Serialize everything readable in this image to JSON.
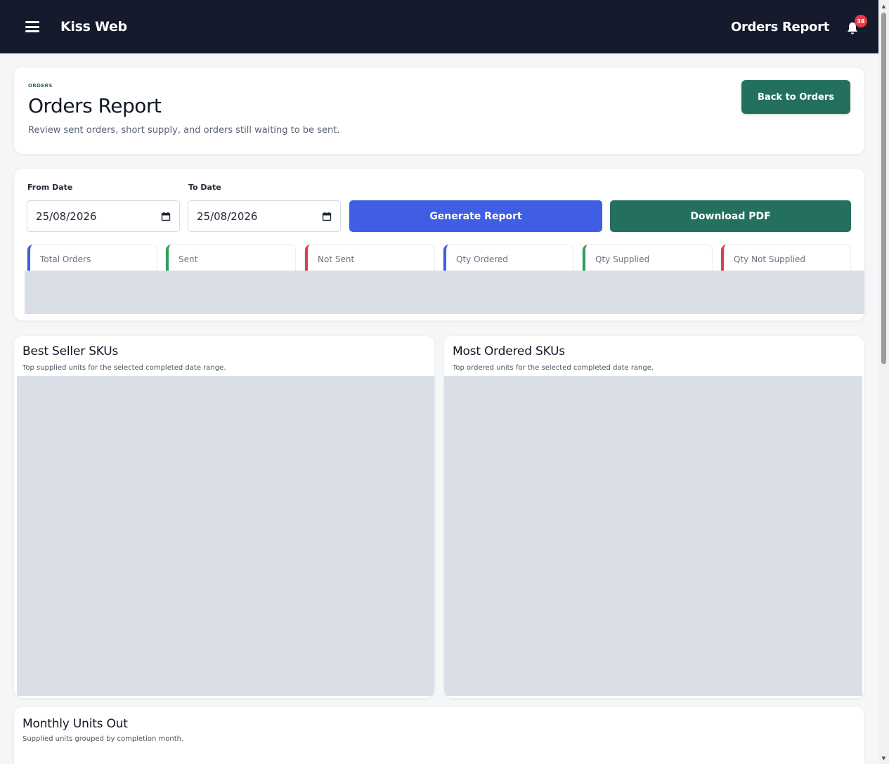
{
  "topbar": {
    "brand": "Kiss Web",
    "page_title": "Orders Report",
    "notification_count": "38"
  },
  "header": {
    "eyebrow": "ORDERS",
    "title": "Orders Report",
    "subtitle": "Review sent orders, short supply, and orders still waiting to be sent.",
    "back_label": "Back to Orders"
  },
  "filters": {
    "from_label": "From Date",
    "from_value": "25/08/2026",
    "to_label": "To Date",
    "to_value": "25/08/2026",
    "generate_label": "Generate Report",
    "download_label": "Download PDF"
  },
  "stats": [
    {
      "label": "Total Orders",
      "color": "#3f5ee3"
    },
    {
      "label": "Sent",
      "color": "#2e9e5b"
    },
    {
      "label": "Not Sent",
      "color": "#d94147"
    },
    {
      "label": "Qty Ordered",
      "color": "#3f5ee3"
    },
    {
      "label": "Qty Supplied",
      "color": "#2e9e5b"
    },
    {
      "label": "Qty Not Supplied",
      "color": "#d94147"
    }
  ],
  "charts": {
    "best_seller": {
      "title": "Best Seller SKUs",
      "subtitle": "Top supplied units for the selected completed date range."
    },
    "most_ordered": {
      "title": "Most Ordered SKUs",
      "subtitle": "Top ordered units for the selected completed date range."
    },
    "monthly": {
      "title": "Monthly Units Out",
      "subtitle": "Supplied units grouped by completion month."
    }
  },
  "icons": {
    "menu": "menu-icon",
    "bell": "bell-icon",
    "calendar": "calendar-icon"
  },
  "colors": {
    "topbar": "#151a2d",
    "primary_green": "#23705f",
    "primary_blue": "#3f5ee3",
    "placeholder": "#d9dee7"
  }
}
